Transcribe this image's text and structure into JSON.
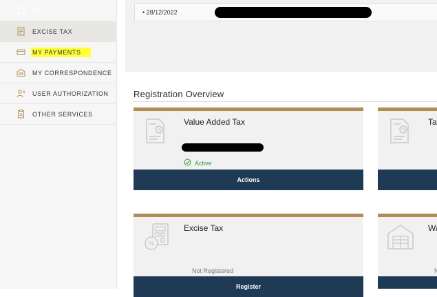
{
  "sidebar": {
    "items": [
      {
        "label": "VAT",
        "icon": "vat-icon"
      },
      {
        "label": "EXCISE TAX",
        "icon": "excise-tax-icon"
      },
      {
        "label": "MY PAYMENTS",
        "icon": "payments-icon"
      },
      {
        "label": "MY CORRESPONDENCE",
        "icon": "correspondence-icon"
      },
      {
        "label": "USER AUTHORIZATION",
        "icon": "user-authorization-icon"
      },
      {
        "label": "OTHER SERVICES",
        "icon": "other-services-icon"
      }
    ],
    "highlight_color": "#ffff3a"
  },
  "top_panel": {
    "date": "• 28/12/2022"
  },
  "registration": {
    "title": "Registration Overview",
    "cards": [
      {
        "name": "Value Added Tax",
        "status": "Active",
        "button": "Actions"
      },
      {
        "name": "Tax",
        "button": ""
      },
      {
        "name": "Excise Tax",
        "status": "Not Registered",
        "button": "Register"
      },
      {
        "name": "Wa",
        "status": "N",
        "button": ""
      }
    ]
  },
  "colors": {
    "accent_gold": "#b08d57",
    "button_navy": "#1f3a55",
    "status_active": "#2f9c3c"
  }
}
